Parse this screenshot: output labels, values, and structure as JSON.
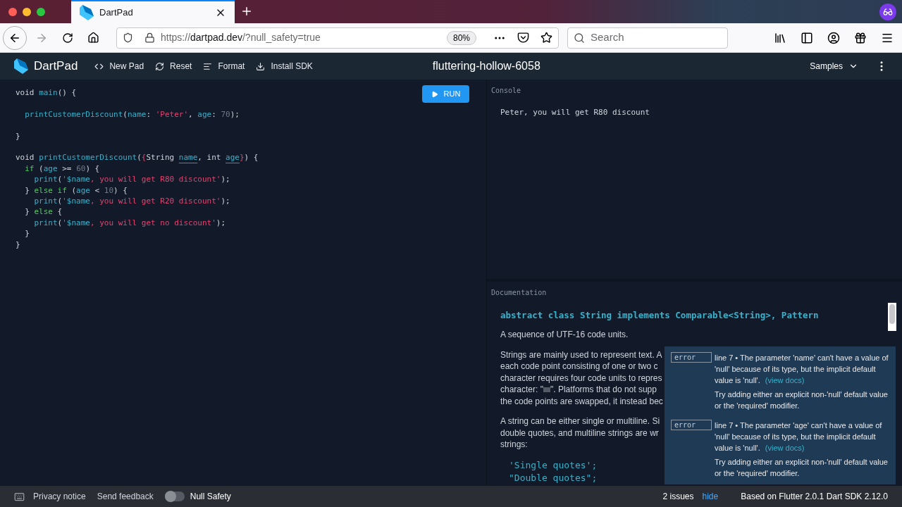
{
  "browser": {
    "tab": {
      "title": "DartPad",
      "selected": true
    },
    "url": {
      "host": "https://dartpad.dev",
      "path": "/?null_safety=true"
    },
    "zoom": "80%",
    "search": {
      "placeholder": "Search"
    }
  },
  "header": {
    "brand": "DartPad",
    "actions": [
      {
        "label": "New Pad",
        "kind": "code"
      },
      {
        "label": "Reset",
        "kind": "refresh"
      },
      {
        "label": "Format",
        "kind": "lines"
      },
      {
        "label": "Install SDK",
        "kind": "download"
      }
    ],
    "title": "fluttering-hollow-6058",
    "samples": "Samples"
  },
  "editor": {
    "run": "RUN",
    "blocks": [
      [
        {
          "tokens": [
            {
              "text": "void ",
              "kind": "plain"
            },
            {
              "text": "main",
              "kind": "fn"
            },
            {
              "text": "() {",
              "kind": "plain"
            }
          ]
        }
      ],
      [
        {
          "tokens": [
            {
              "text": "  printCustomerDiscount",
              "kind": "fn"
            },
            {
              "text": "(",
              "kind": "plain"
            },
            {
              "text": "name",
              "kind": "fn"
            },
            {
              "text": ": ",
              "kind": "plain"
            },
            {
              "text": "'Peter'",
              "kind": "str"
            },
            {
              "text": ", ",
              "kind": "plain"
            },
            {
              "text": "age",
              "kind": "fn"
            },
            {
              "text": ": ",
              "kind": "plain"
            },
            {
              "text": "70",
              "kind": "num"
            },
            {
              "text": ");",
              "kind": "plain"
            }
          ]
        }
      ],
      [
        {
          "tokens": [
            {
              "text": "}",
              "kind": "plain"
            }
          ]
        }
      ],
      [
        {
          "tokens": [
            {
              "text": "void ",
              "kind": "plain"
            },
            {
              "text": "printCustomerDiscount",
              "kind": "fn"
            },
            {
              "text": "(",
              "kind": "plain"
            },
            {
              "text": "{",
              "kind": "str"
            },
            {
              "text": "String ",
              "kind": "plain"
            },
            {
              "text": "name",
              "kind": "err"
            },
            {
              "text": ", int ",
              "kind": "plain"
            },
            {
              "text": "age",
              "kind": "err"
            },
            {
              "text": "}",
              "kind": "str"
            },
            {
              "text": ") {",
              "kind": "plain"
            }
          ]
        },
        {
          "tokens": [
            {
              "text": "  if",
              "kind": "kw"
            },
            {
              "text": " (",
              "kind": "plain"
            },
            {
              "text": "age",
              "kind": "fn"
            },
            {
              "text": " >= ",
              "kind": "plain"
            },
            {
              "text": "60",
              "kind": "num"
            },
            {
              "text": ") {",
              "kind": "plain"
            }
          ]
        },
        {
          "tokens": [
            {
              "text": "    print",
              "kind": "fn"
            },
            {
              "text": "(",
              "kind": "plain"
            },
            {
              "text": "'",
              "kind": "str"
            },
            {
              "text": "$name",
              "kind": "fn"
            },
            {
              "text": ", you will get R80 discount'",
              "kind": "str"
            },
            {
              "text": ");",
              "kind": "plain"
            }
          ]
        },
        {
          "tokens": [
            {
              "text": "  } ",
              "kind": "plain"
            },
            {
              "text": "else if",
              "kind": "kw"
            },
            {
              "text": " (",
              "kind": "plain"
            },
            {
              "text": "age",
              "kind": "fn"
            },
            {
              "text": " < ",
              "kind": "plain"
            },
            {
              "text": "10",
              "kind": "num"
            },
            {
              "text": ") {",
              "kind": "plain"
            }
          ]
        },
        {
          "tokens": [
            {
              "text": "    print",
              "kind": "fn"
            },
            {
              "text": "(",
              "kind": "plain"
            },
            {
              "text": "'",
              "kind": "str"
            },
            {
              "text": "$name",
              "kind": "fn"
            },
            {
              "text": ", you will get R20 discount'",
              "kind": "str"
            },
            {
              "text": ");",
              "kind": "plain"
            }
          ]
        },
        {
          "tokens": [
            {
              "text": "  } ",
              "kind": "plain"
            },
            {
              "text": "else",
              "kind": "kw"
            },
            {
              "text": " {",
              "kind": "plain"
            }
          ]
        },
        {
          "tokens": [
            {
              "text": "    print",
              "kind": "fn"
            },
            {
              "text": "(",
              "kind": "plain"
            },
            {
              "text": "'",
              "kind": "str"
            },
            {
              "text": "$name",
              "kind": "fn"
            },
            {
              "text": ", you will get no discount'",
              "kind": "str"
            },
            {
              "text": ");",
              "kind": "plain"
            }
          ]
        },
        {
          "tokens": [
            {
              "text": "  }",
              "kind": "plain"
            }
          ]
        },
        {
          "tokens": [
            {
              "text": "}",
              "kind": "plain"
            }
          ]
        }
      ]
    ]
  },
  "console": {
    "label": "Console",
    "output": "Peter, you will get R80 discount"
  },
  "documentation": {
    "label": "Documentation",
    "heading": "abstract class String implements Comparable<String>, Pattern",
    "summary": "A sequence of UTF-16 code units.",
    "paragraphs": [
      [
        "Strings are mainly used to represent text. A",
        "each code point consisting of one or two c",
        "character requires four code units to repres",
        "character: \"",
        "\". Platforms that do not supp",
        "the code points are swapped, it instead bec"
      ],
      [
        "A string can be either single or multiline. Si",
        "double quotes, and multiline strings are wr",
        "strings:"
      ]
    ],
    "code": [
      "'Single quotes';",
      "\"Double quotes\";"
    ]
  },
  "issues": [
    {
      "badge": "error",
      "text": "line 7 • The parameter 'name' can't have a value of 'null' because of its type, but the implicit default value is 'null'.",
      "link": "(view docs)",
      "fix": "Try adding either an explicit non-'null' default value or the 'required' modifier."
    },
    {
      "badge": "error",
      "text": "line 7 • The parameter 'age' can't have a value of 'null' because of its type, but the implicit default value is 'null'.",
      "link": "(view docs)",
      "fix": "Try adding either an explicit non-'null' default value or the 'required' modifier."
    }
  ],
  "footer": {
    "privacy": "Privacy notice",
    "feedback": "Send feedback",
    "null_safety": {
      "label": "Null Safety",
      "on": false
    },
    "issues_count": "2 issues",
    "hide": "hide",
    "version": "Based on Flutter 2.0.1 Dart SDK 2.12.0"
  }
}
